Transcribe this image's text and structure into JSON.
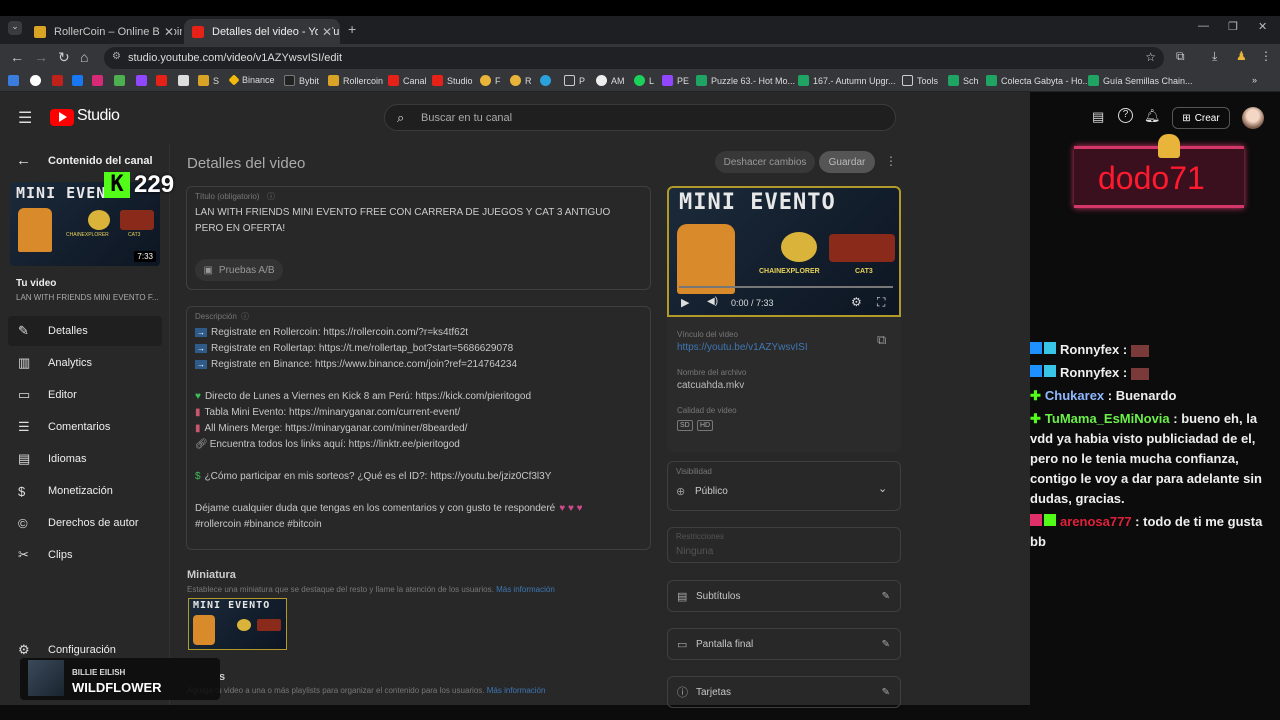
{
  "tabs": [
    {
      "title": "RollerCoin – Online Bitcoin Mining"
    },
    {
      "title": "Detalles del video - YouTube Studio"
    }
  ],
  "address": "studio.youtube.com/video/v1AZYwsvISI/edit",
  "bookmarks": [
    "S",
    "Binance",
    "Bybit",
    "Rollercoin",
    "Canal",
    "Studio",
    "F",
    "R",
    "P",
    "AM",
    "L",
    "PE",
    "Puzzle 63.- Hot Mo...",
    "167.- Autumn Upgr...",
    "Tools",
    "Sch",
    "Colecta Gabyta - Ho...",
    "Guía Semillas Chain..."
  ],
  "studio": {
    "logo": "Studio",
    "search_placeholder": "Buscar en tu canal",
    "create_label": "Crear",
    "back_label": "Contenido del canal",
    "thumb_duration": "7:33",
    "your_video": "Tu video",
    "your_video_title": "LAN WITH FRIENDS MINI EVENTO F...",
    "nav": [
      {
        "label": "Detalles",
        "icon": "pencil-icon"
      },
      {
        "label": "Analytics",
        "icon": "analytics-icon"
      },
      {
        "label": "Editor",
        "icon": "editor-icon"
      },
      {
        "label": "Comentarios",
        "icon": "comments-icon"
      },
      {
        "label": "Idiomas",
        "icon": "subtitles-icon"
      },
      {
        "label": "Monetización",
        "icon": "dollar-icon"
      },
      {
        "label": "Derechos de autor",
        "icon": "copyright-icon"
      },
      {
        "label": "Clips",
        "icon": "scissors-icon"
      }
    ],
    "settings_label": "Configuración",
    "page_title": "Detalles del video",
    "undo_label": "Deshacer cambios",
    "save_label": "Guardar",
    "title_label": "Título (obligatorio)",
    "title_value": "LAN WITH FRIENDS MINI EVENTO FREE CON CARRERA DE JUEGOS Y CAT 3 ANTIGUO PERO EN OFERTA!",
    "ab_label": "Pruebas A/B",
    "desc_label": "Descripción",
    "desc_lines": [
      "Registrate en Rollercoin: https://rollercoin.com/?r=ks4tf62t",
      "Registrate en Rollertap: https://t.me/rollertap_bot?start=5686629078",
      "Registrate en Binance: https://www.binance.com/join?ref=214764234",
      "",
      "Directo de Lunes a Viernes en Kick 8 am Perú: https://kick.com/pieritogod",
      "Tabla Mini Evento: https://minaryganar.com/current-event/",
      "All Miners Merge: https://minaryganar.com/miner/8bearded/",
      "Encuentra todos los links aquí: https://linktr.ee/pieritogod",
      "",
      "¿Cómo participar en mis sorteos? ¿Qué es el ID?: https://youtu.be/jziz0Cf3l3Y",
      "",
      "Déjame cualquier duda que tengas en los comentarios y con gusto te responderé",
      "#rollercoin #binance #bitcoin"
    ],
    "miniatura_label": "Miniatura",
    "miniatura_desc": "Establece una miniatura que se destaque del resto y llame la atención de los usuarios.",
    "mas_info": "Más información",
    "playlists_label": "s",
    "playlists_desc": "Agrega tu video a una o más playlists para organizar el contenido para los usuarios.",
    "player_time": "0:00 / 7:33",
    "link_label": "Vínculo del video",
    "link_value": "https://youtu.be/v1AZYwsvISI",
    "file_label": "Nombre del archivo",
    "file_value": "catcuahda.mkv",
    "quality_label": "Calidad de video",
    "quality_badges": [
      "SD",
      "HD"
    ],
    "visibility_label": "Visibilidad",
    "visibility_value": "Público",
    "restrictions_label": "Restricciones",
    "restrictions_value": "Ninguna",
    "cards": [
      {
        "label": "Subtítulos",
        "icon": "subtitles-icon"
      },
      {
        "label": "Pantalla final",
        "icon": "end-screen-icon"
      },
      {
        "label": "Tarjetas",
        "icon": "info-icon"
      }
    ]
  },
  "overlay": {
    "thumb_text": "MINI EVENTO",
    "thumb_sub1": "CHAINEXPLORER",
    "thumb_sub2": "CAT3",
    "viewer_count": "229",
    "alert_name": "dodo71",
    "song_artist": "BILLIE EILISH",
    "song_title": "WILDFLOWER"
  },
  "chat": [
    {
      "user": "Ronnyfex",
      "msg": "",
      "color": "#ffffff"
    },
    {
      "user": "Ronnyfex",
      "msg": "",
      "color": "#ffffff"
    },
    {
      "user": "Chukarex",
      "msg": "Buenardo",
      "color": "#8fb8ff"
    },
    {
      "user": "TuMama_EsMiNovia",
      "msg": "bueno eh, la vdd ya habia visto publiciadad de el, pero no le tenia mucha confianza, contigo le voy a dar para adelante sin dudas, gracias.",
      "color": "#6cf04a"
    },
    {
      "user": "arenosa777",
      "msg": "todo de ti me gusta bb",
      "color": "#e0203a"
    }
  ]
}
